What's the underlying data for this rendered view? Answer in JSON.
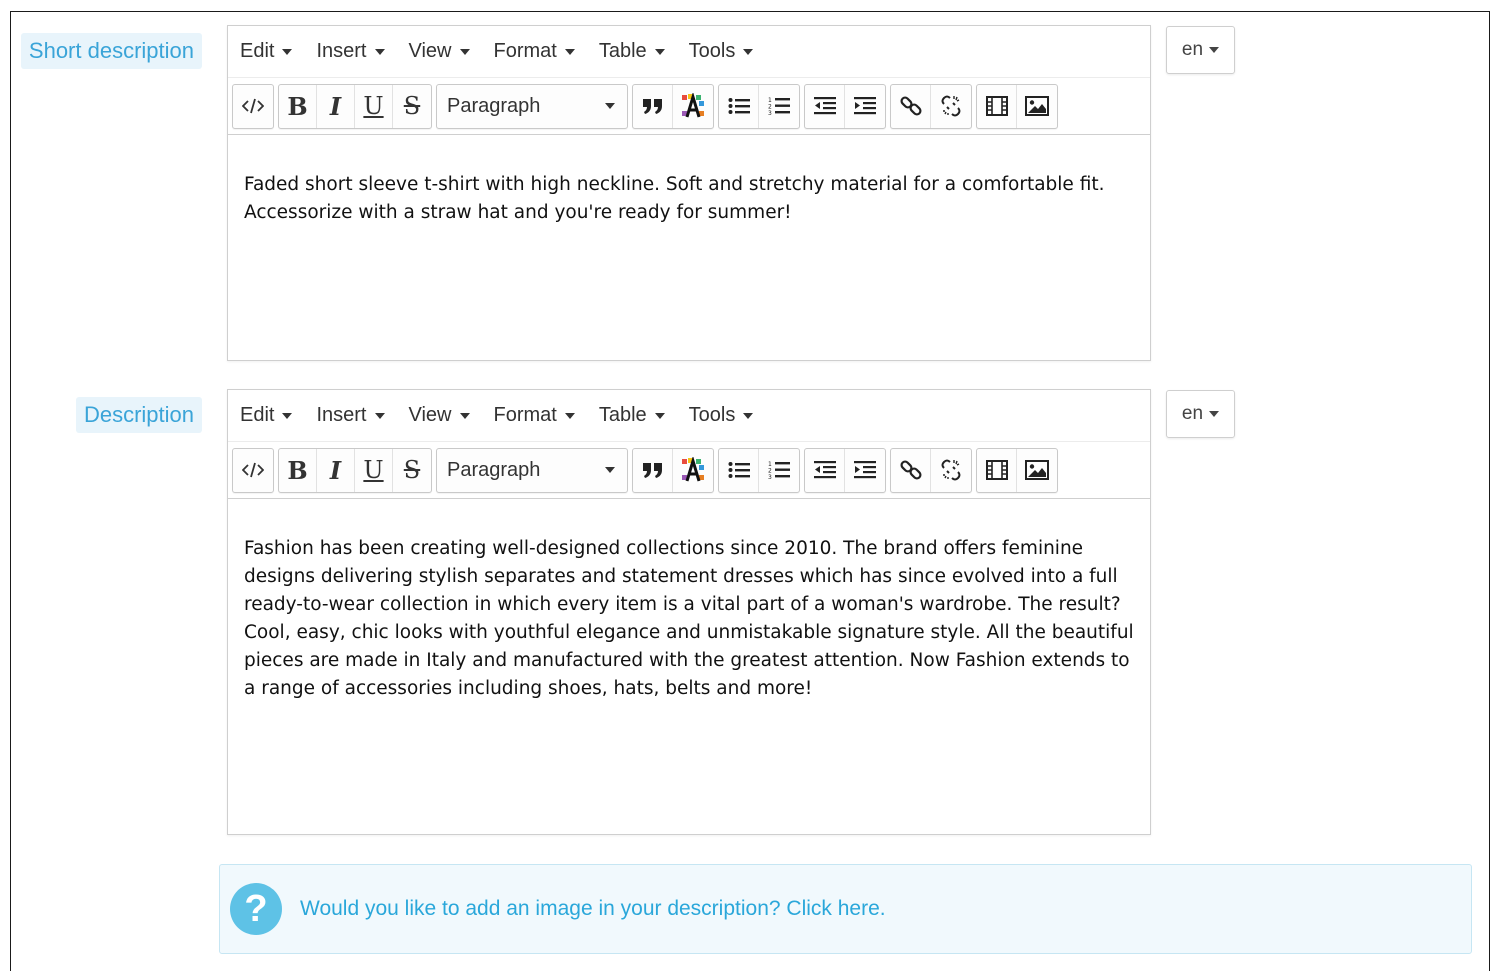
{
  "fields": [
    {
      "label": "Short description",
      "menu": [
        "Edit",
        "Insert",
        "View",
        "Format",
        "Table",
        "Tools"
      ],
      "block_format": "Paragraph",
      "content": "Faded short sleeve t-shirt with high neckline. Soft and stretchy material for a comfortable fit. Accessorize with a straw hat and you're ready for summer!",
      "language": "en"
    },
    {
      "label": "Description",
      "menu": [
        "Edit",
        "Insert",
        "View",
        "Format",
        "Table",
        "Tools"
      ],
      "block_format": "Paragraph",
      "content": "Fashion has been creating well-designed collections since 2010. The brand offers feminine designs delivering stylish separates and statement dresses which has since evolved into a full ready-to-wear collection in which every item is a vital part of a woman's wardrobe. The result? Cool, easy, chic looks with youthful elegance and unmistakable signature style. All the beautiful pieces are made in Italy and manufactured with the greatest attention. Now Fashion extends to a range of accessories including shoes, hats, belts and more!",
      "language": "en"
    }
  ],
  "toolbar_icons": [
    "code-icon",
    "bold-icon",
    "italic-icon",
    "underline-icon",
    "strikethrough-icon",
    "blockquote-icon",
    "text-color-icon",
    "bullet-list-icon",
    "numbered-list-icon",
    "outdent-icon",
    "indent-icon",
    "link-icon",
    "unlink-icon",
    "media-icon",
    "image-icon"
  ],
  "help": {
    "text": "Would you like to add an image in your description?",
    "link": "Click here."
  },
  "colors": {
    "label_text": "#3aa4d8",
    "label_bg": "#e8f4fb",
    "help_text": "#2aa7da",
    "help_icon": "#5ec2e6"
  }
}
